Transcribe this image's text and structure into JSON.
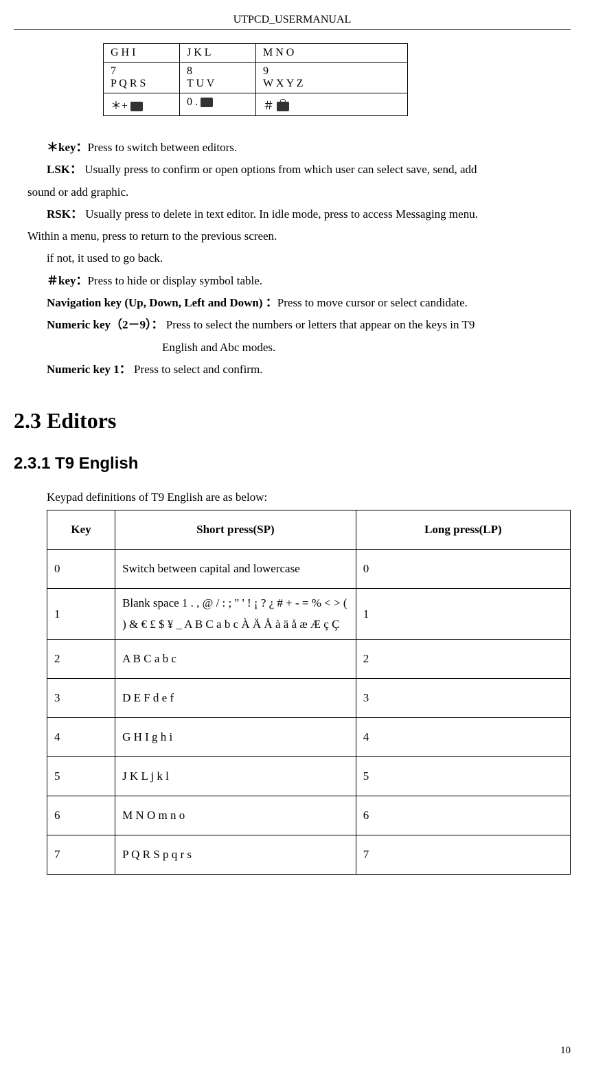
{
  "header": "UTPCD_USERMANUAL",
  "keypad": {
    "r0c0": "G H I",
    "r0c1": "J K L",
    "r0c2": "M N O",
    "r1c0a": "7",
    "r1c0b": "P Q R S",
    "r1c1a": "8",
    "r1c1b": "T U V",
    "r1c2a": "9",
    "r1c2b": "W X Y Z",
    "r2c0": "＊+ ",
    "r2c1": "0 . ",
    "r2c2": "＃ "
  },
  "defs": {
    "star_label": "＊key：",
    "star_text": "Press to switch between editors.",
    "lsk_label": "LSK：",
    "lsk_text_a": " Usually press to confirm or open options from which user can select save, send, add",
    "lsk_text_b": "sound or add graphic.",
    "rsk_label": "RSK：",
    "rsk_text_a": " Usually press to delete in text editor. In idle mode, press to access Messaging menu.",
    "rsk_text_b": "Within a menu, press to return to the previous screen.",
    "ifnot": "if not, it used to go back.",
    "hash_label": "＃key：",
    "hash_text": "Press to hide or display symbol table.",
    "nav_label": "Navigation key (Up, Down, Left and Down) ：",
    "nav_text": "Press to move cursor or select candidate.",
    "num29_label": "Numeric key（2－9）：",
    "num29_text_a": " Press to select the numbers or letters that appear on the keys in T9",
    "num29_text_b": "English and Abc modes.",
    "num1_label": "Numeric key 1：",
    "num1_text": " Press to select and confirm."
  },
  "section_title": "2.3 Editors",
  "subsection_title": "2.3.1 T9 English",
  "t9_intro": "Keypad definitions of T9 English are as below:",
  "t9": {
    "h_key": "Key",
    "h_sp": "Short press(SP)",
    "h_lp": "Long press(LP)",
    "rows": [
      {
        "k": "0",
        "sp": "Switch between capital and lowercase",
        "lp": "0"
      },
      {
        "k": "1",
        "sp": "Blank space 1 . , @ / : ; \" ' ! ¡ ? ¿ # + - = % < > ( ) & € £ $ ¥ _ A B C a b c À Ä Å à ä å æ Æ ç Ç",
        "lp": "1"
      },
      {
        "k": "2",
        "sp": "A B C a b c",
        "lp": "2"
      },
      {
        "k": "3",
        "sp": "D E F d e f",
        "lp": "3"
      },
      {
        "k": "4",
        "sp": "G H I g h i",
        "lp": "4"
      },
      {
        "k": "5",
        "sp": "J K L j k l",
        "lp": "5"
      },
      {
        "k": "6",
        "sp": "M N O m n o",
        "lp": "6"
      },
      {
        "k": "7",
        "sp": "P Q R S p q r s",
        "lp": "7"
      }
    ]
  },
  "page_number": "10"
}
